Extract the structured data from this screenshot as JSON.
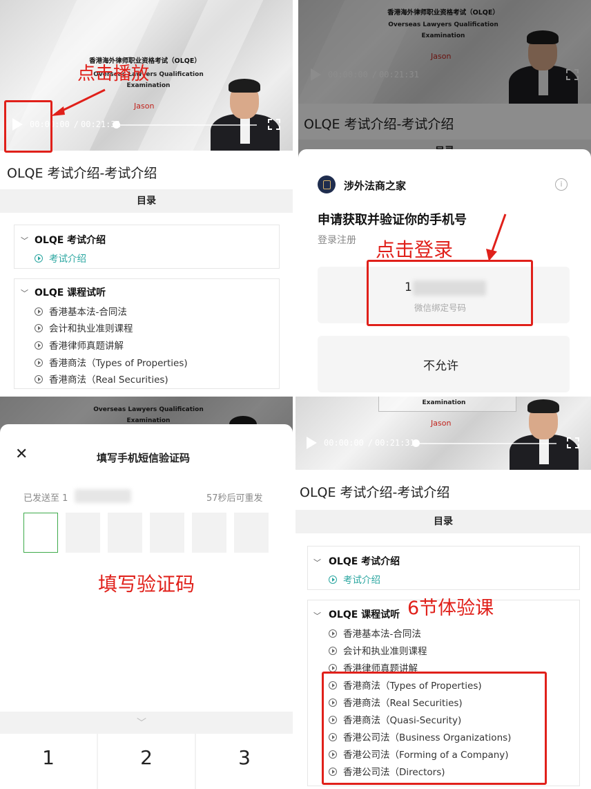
{
  "video": {
    "slide_title_cn": "香港海外律师职业资格考试（OLQE）",
    "slide_title_en_1": "Overseas Lawyers Qualification",
    "slide_title_en_2": "Examination",
    "presenter_name": "Jason",
    "time_current": "00:00:00",
    "time_separator": "/",
    "time_total": "00:21:31"
  },
  "page_title": "OLQE 考试介绍-考试介绍",
  "toc_label": "目录",
  "sections": [
    {
      "title": "OLQE 考试介绍",
      "items": [
        "考试介绍"
      ]
    },
    {
      "title": "OLQE 课程试听",
      "items": [
        "香港基本法-合同法",
        "会计和执业准则课程",
        "香港律师真题讲解",
        "香港商法（Types of Properties)",
        "香港商法（Real Securities)",
        "香港商法（Quasi-Security)",
        "香港公司法（Business Organizations)",
        "香港公司法（Forming of a Company)",
        "香港公司法（Directors)"
      ]
    }
  ],
  "auth_sheet": {
    "brand_name": "涉外法商之家",
    "info_icon": "i",
    "heading": "申请获取并验证你的手机号",
    "subheading": "登录注册",
    "phone_prefix": "1",
    "phone_caption": "微信绑定号码",
    "deny_label": "不允许"
  },
  "sms_sheet": {
    "title": "填写手机短信验证码",
    "sent_to_prefix": "已发送至 1",
    "resend_text": "57秒后可重发",
    "keypad_keys": [
      "1",
      "2",
      "3"
    ]
  },
  "annotations": {
    "click_play": "点击播放",
    "click_login": "点击登录",
    "fill_code": "填写验证码",
    "six_lessons": "6节体验课"
  },
  "colors": {
    "accent_red": "#e0201a",
    "accent_teal": "#2aa6a0",
    "focus_green": "#3daa4a"
  }
}
